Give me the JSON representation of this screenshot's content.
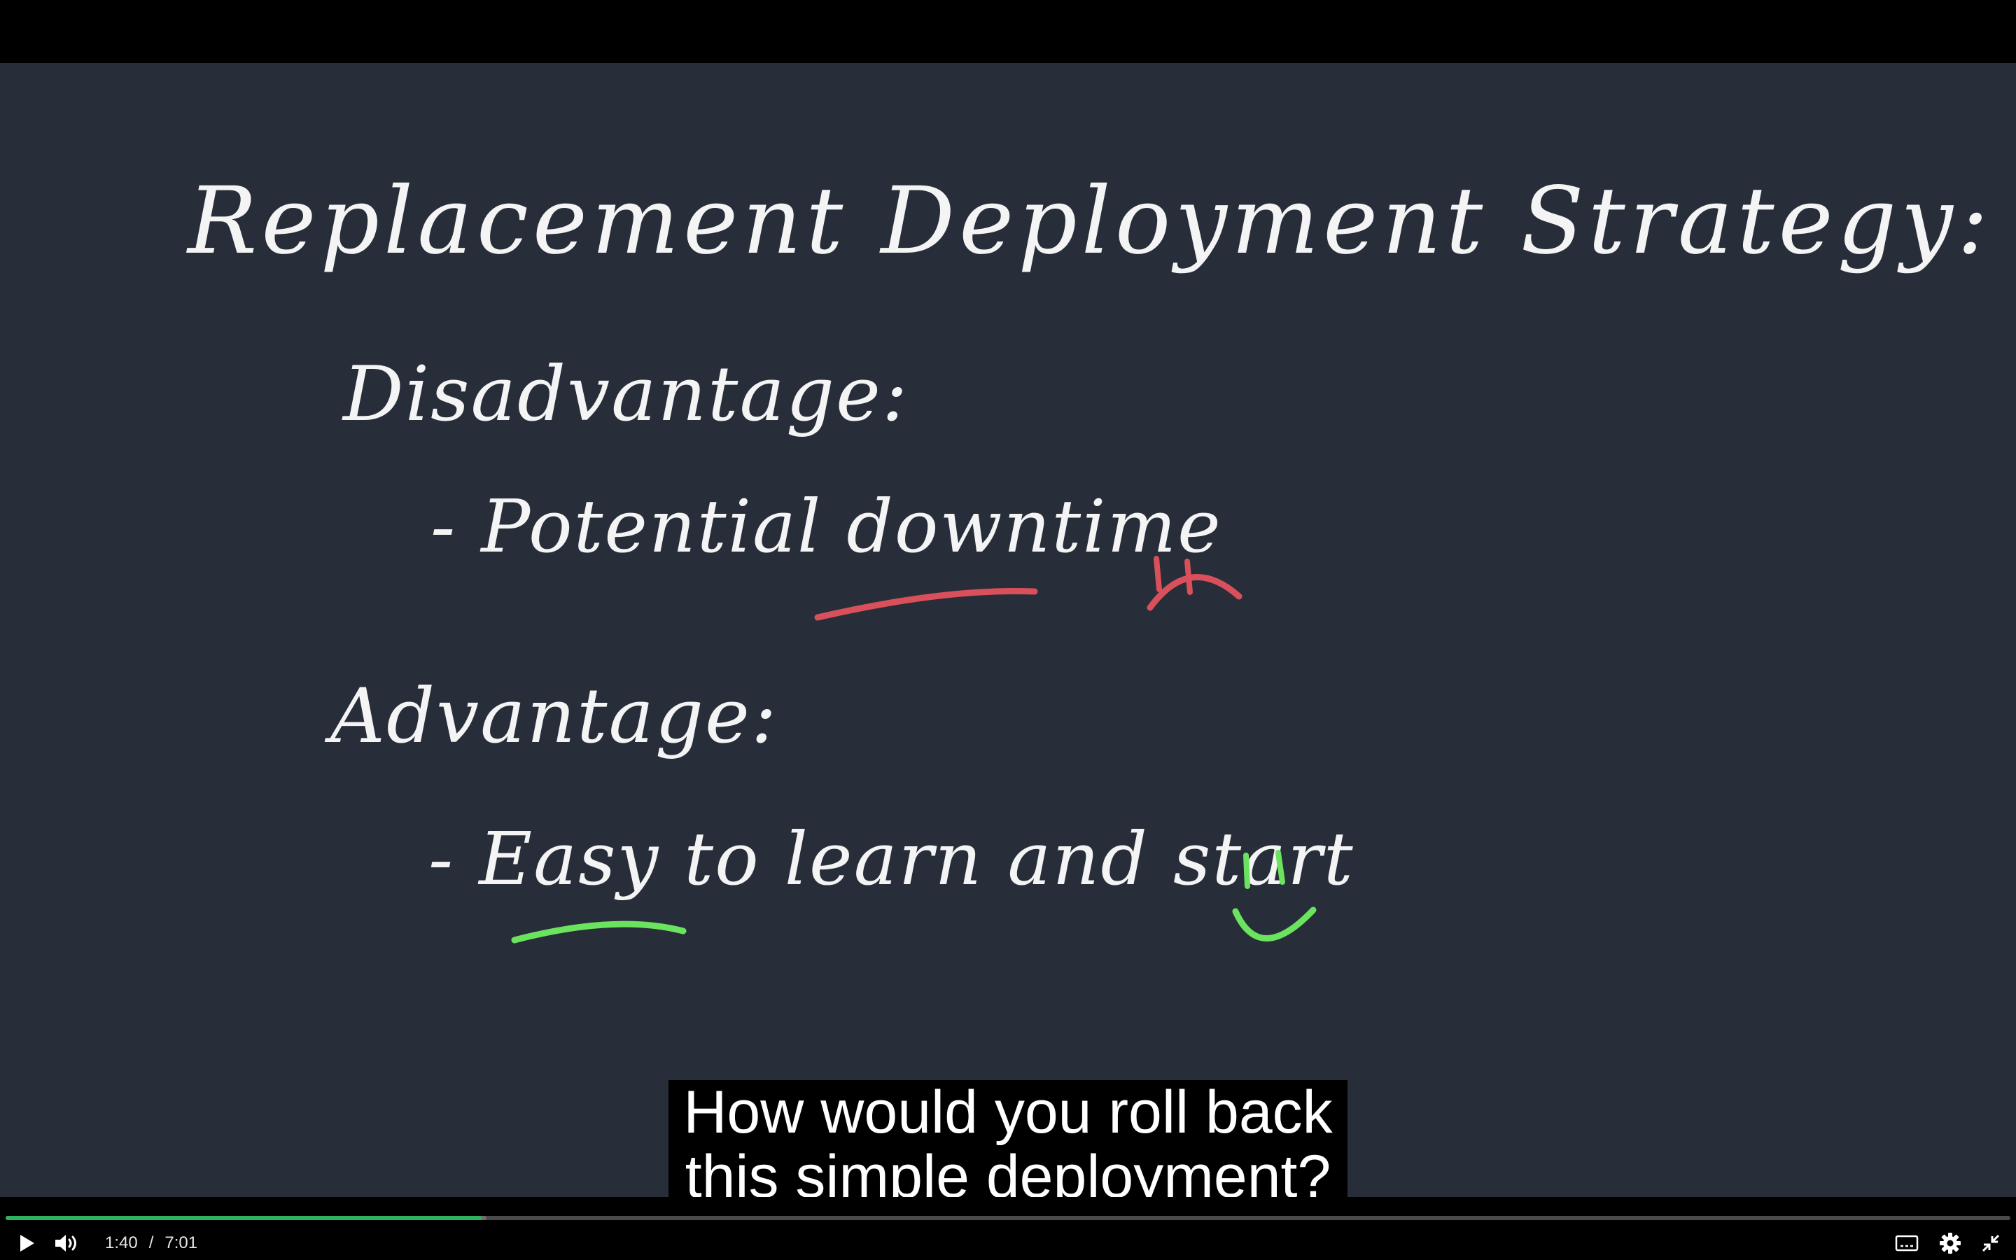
{
  "board": {
    "title": "Replacement Deployment Strategy:",
    "disadvantage_heading": "Disadvantage:",
    "disadvantage_item": "- Potential downtime",
    "advantage_heading": "Advantage:",
    "advantage_item": "- Easy to learn and start"
  },
  "colors": {
    "board_background": "#272e3a",
    "chalk_white": "#f4f4f4",
    "sad_red": "#d9505b",
    "happy_green": "#6be35f",
    "progress_green": "#2db35d"
  },
  "subtitle": {
    "line1": "How would you roll back",
    "line2": "this simple deployment?"
  },
  "player": {
    "current_time": "1:40",
    "separator": "/",
    "duration": "7:01",
    "progress_fraction": 0.2375,
    "buffered_fraction": 0.24,
    "icons": {
      "play": "play-icon",
      "volume": "volume-icon",
      "captions": "captions-icon",
      "settings": "gear-icon",
      "fullscreen": "exit-fullscreen-icon"
    }
  }
}
